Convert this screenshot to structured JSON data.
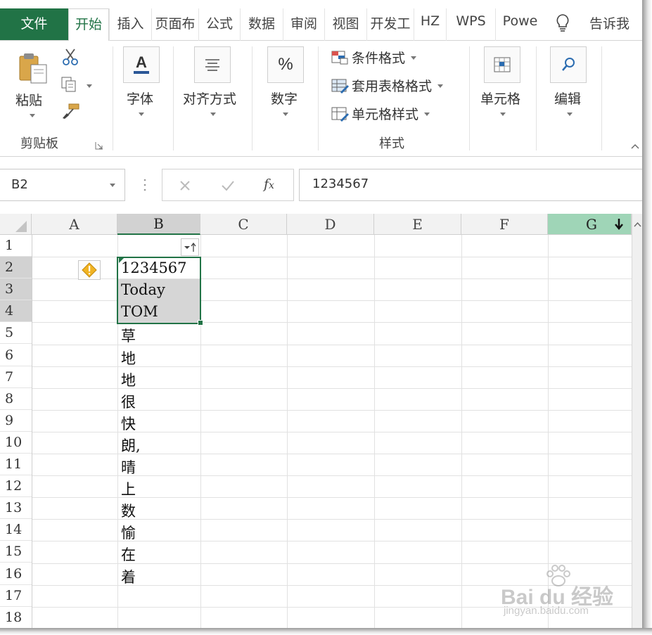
{
  "tabs": [
    {
      "label": "文件"
    },
    {
      "label": "开始"
    },
    {
      "label": "插入"
    },
    {
      "label": "页面布"
    },
    {
      "label": "公式"
    },
    {
      "label": "数据"
    },
    {
      "label": "审阅"
    },
    {
      "label": "视图"
    },
    {
      "label": "开发工"
    },
    {
      "label": "HZ"
    },
    {
      "label": "WPS"
    },
    {
      "label": "Powe"
    },
    {
      "label": "告诉我"
    }
  ],
  "ribbon": {
    "paste": "粘贴",
    "clipboard_group": "剪贴板",
    "font": "字体",
    "alignment": "对齐方式",
    "number": "数字",
    "conditional_format": "条件格式",
    "format_as_table": "套用表格格式",
    "cell_styles": "单元格样式",
    "styles_group": "样式",
    "cells": "单元格",
    "editing": "编辑"
  },
  "formula_bar": {
    "name_box": "B2",
    "value": "1234567"
  },
  "grid": {
    "columns": [
      "A",
      "B",
      "C",
      "D",
      "E",
      "F",
      "G"
    ],
    "rows": [
      "1",
      "2",
      "3",
      "4",
      "5",
      "6",
      "7",
      "8",
      "9",
      "10",
      "11",
      "12",
      "13",
      "14",
      "15",
      "16",
      "17",
      "18"
    ],
    "column_b": [
      "",
      "1234567",
      "Today",
      "TOM",
      "草",
      "地",
      "地",
      "很",
      "快",
      "朗,",
      "晴",
      "上",
      "数",
      "愉",
      "在",
      "着",
      "",
      ""
    ]
  },
  "watermark": {
    "brand": "Bai du 经验",
    "url": "jingyan.baidu.com"
  },
  "colors": {
    "excel_green": "#217346",
    "selection_gray": "#d6d6d6",
    "column_g_highlight": "#9fd5b7"
  },
  "icons": [
    "paste-icon",
    "cut-icon",
    "copy-icon",
    "format-painter-icon",
    "font-color-icon",
    "align-icon",
    "percent-icon",
    "conditional-format-icon",
    "table-format-icon",
    "cell-style-icon",
    "cells-icon",
    "search-icon",
    "lightbulb-icon",
    "warning-icon",
    "filter-sort-icon",
    "cancel-icon",
    "confirm-icon",
    "fx-icon"
  ]
}
